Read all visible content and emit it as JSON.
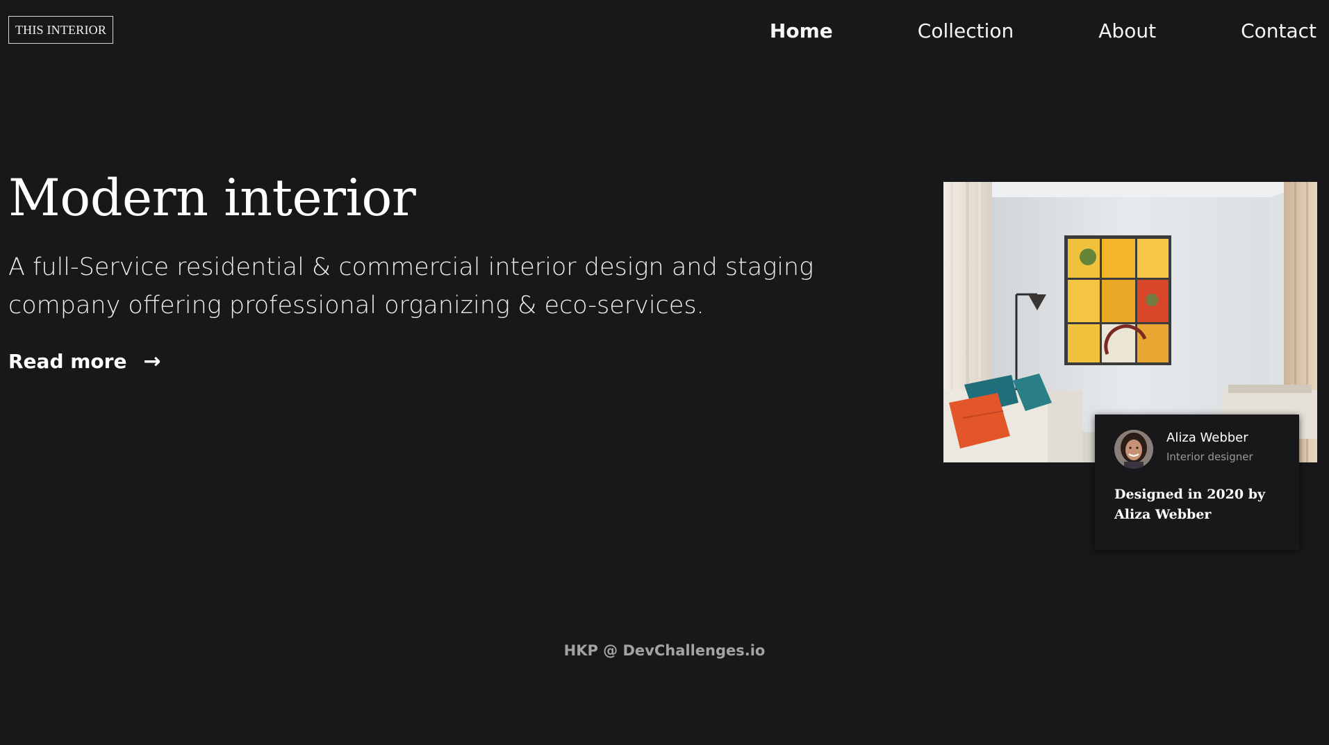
{
  "header": {
    "logo_text": "THIS INTERIOR",
    "nav": [
      {
        "label": "Home",
        "active": true
      },
      {
        "label": "Collection",
        "active": false
      },
      {
        "label": "About",
        "active": false
      },
      {
        "label": "Contact",
        "active": false
      }
    ]
  },
  "hero": {
    "title": "Modern interior",
    "description": "A full-Service residential & commercial interior design and staging company offering professional organizing & eco-services.",
    "read_more_label": "Read more",
    "read_more_arrow": "→"
  },
  "card": {
    "name": "Aliza Webber",
    "role": "Interior designer",
    "designed_text": "Designed in 2020 by Aliza Webber"
  },
  "footer": {
    "text": "HKP @ DevChallenges.io"
  },
  "colors": {
    "background": "#18181a",
    "text": "#ffffff",
    "muted": "#9a9a9a",
    "footer": "#a3a3a3"
  }
}
